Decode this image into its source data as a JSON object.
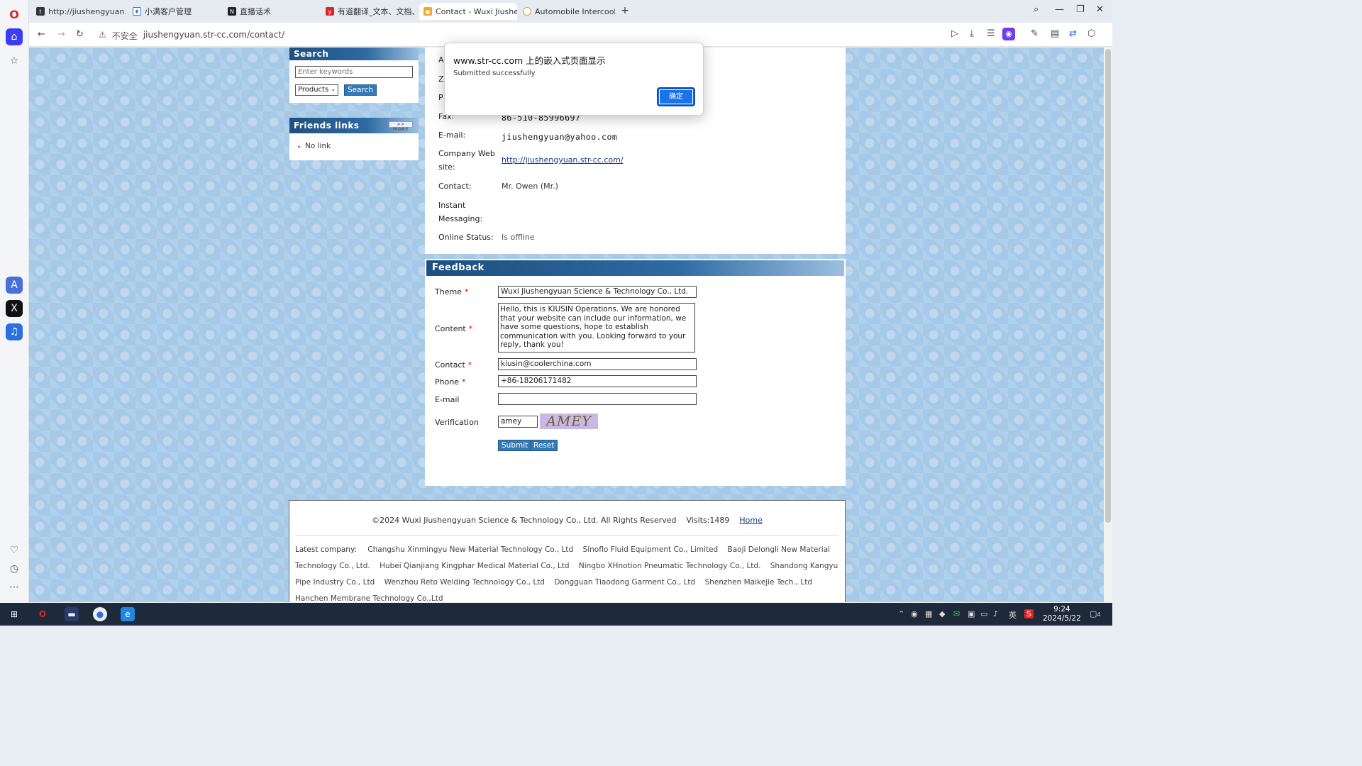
{
  "browser": {
    "tabs": [
      {
        "title": "http://jiushengyuan.str-",
        "active": false
      },
      {
        "title": "小满客户管理",
        "active": false
      },
      {
        "title": "直播话术",
        "active": false
      },
      {
        "title": "有道翻译_文本、文档、网",
        "active": false
      },
      {
        "title": "Contact - Wuxi Jiusheng",
        "active": true
      },
      {
        "title": "Automobile Intercooler,",
        "active": false
      }
    ],
    "new_tab": "+",
    "security_label": "不安全",
    "url": "jiushengyuan.str-cc.com/contact/"
  },
  "sidebar": {
    "search": {
      "title": "Search",
      "placeholder": "Enter keywords",
      "category": "Products",
      "button": "Search"
    },
    "friends": {
      "title": "Friends links",
      "more": ">> MORE",
      "items": [
        "No link"
      ]
    }
  },
  "contact_info": {
    "rows": [
      {
        "label": "Fax:",
        "value": "86-510-85996697"
      },
      {
        "label": "E-mail:",
        "value": "jiushengyuan@yahoo.com"
      },
      {
        "label": "Company Web site:",
        "value": "http://jiushengyuan.str-cc.com/"
      },
      {
        "label": "Contact:",
        "value": "Mr. Owen   (Mr.)"
      },
      {
        "label": "Instant Messaging:",
        "value": ""
      },
      {
        "label": "Online Status:",
        "value": "Is offline"
      }
    ],
    "partial_labels": [
      "A",
      "Z",
      "P"
    ]
  },
  "feedback": {
    "title": "Feedback",
    "theme_label": "Theme",
    "theme_value": "Wuxi Jiushengyuan Science & Technology Co., Ltd.",
    "content_label": "Content",
    "content_value": "Hello, this is KIUSIN Operations. We are honored that your website can include our information, we have some questions, hope to establish communication with you. Looking forward to your reply, thank you!",
    "contact_label": "Contact",
    "contact_value": "kiusin@coolerchina.com",
    "phone_label": "Phone",
    "phone_value": "+86-18206171482",
    "email_label": "E-mail",
    "email_value": "",
    "verification_label": "Verification",
    "verification_value": "amey",
    "captcha_text": "AMEY",
    "required_mark": "*",
    "submit": "Submit",
    "reset": "Reset"
  },
  "footer": {
    "copyright": "©2024 Wuxi Jiushengyuan Science & Technology Co., Ltd. All Rights Reserved",
    "visits": "Visits:1489",
    "home": "Home",
    "latest_label": "Latest company:",
    "companies": [
      "Changshu Xinmingyu New Material Technology Co., Ltd",
      "Sinoflo Fluid Equipment Co., Limited",
      "Baoji Delongli New Material Technology Co., Ltd.",
      "Hubei Qianjiang Kingphar Medical Material Co., Ltd",
      "Ningbo XHnotion Pneumatic Technology Co., Ltd.",
      "Shandong Kangyu Pipe Industry Co., Ltd",
      "Wenzhou Reto Welding Technology Co., Ltd",
      "Dongguan Tiaodong Garment Co., Ltd",
      "Shenzhen Maikejie Tech., Ltd",
      "Hanchen Membrane Technology Co.,Ltd"
    ]
  },
  "dialog": {
    "title": "www.str-cc.com 上的嵌入式页面显示",
    "message": "Submitted successfully",
    "ok": "确定"
  },
  "taskbar": {
    "time": "9:24",
    "date": "2024/5/22",
    "ime": "英",
    "notifications": "4"
  }
}
